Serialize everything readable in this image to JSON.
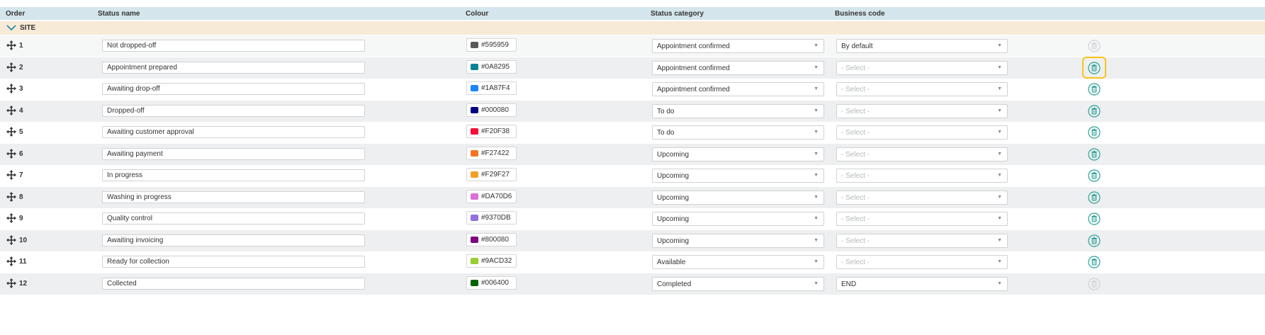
{
  "columns": {
    "order": "Order",
    "status_name": "Status name",
    "colour": "Colour",
    "status_category": "Status category",
    "business_code": "Business code"
  },
  "group": {
    "label": "SITE"
  },
  "rows": [
    {
      "order": "1",
      "name": "Not dropped-off",
      "hex": "#595959",
      "color": "#595959",
      "category": "Appointment confirmed",
      "business": "By default",
      "business_placeholder": false,
      "delete_enabled": false
    },
    {
      "order": "2",
      "name": "Appointment prepared",
      "hex": "#0A8295",
      "color": "#0A8295",
      "category": "Appointment confirmed",
      "business": "- Select -",
      "business_placeholder": true,
      "delete_enabled": true
    },
    {
      "order": "3",
      "name": "Awaiting drop-off",
      "hex": "#1A87F4",
      "color": "#1A87F4",
      "category": "Appointment confirmed",
      "business": "- Select -",
      "business_placeholder": true,
      "delete_enabled": true
    },
    {
      "order": "4",
      "name": "Dropped-off",
      "hex": "#000080",
      "color": "#000080",
      "category": "To do",
      "business": "- Select -",
      "business_placeholder": true,
      "delete_enabled": true
    },
    {
      "order": "5",
      "name": "Awaiting customer approval",
      "hex": "#F20F38",
      "color": "#F20F38",
      "category": "To do",
      "business": "- Select -",
      "business_placeholder": true,
      "delete_enabled": true
    },
    {
      "order": "6",
      "name": "Awaiting payment",
      "hex": "#F27422",
      "color": "#F27422",
      "category": "Upcoming",
      "business": "- Select -",
      "business_placeholder": true,
      "delete_enabled": true
    },
    {
      "order": "7",
      "name": "In progress",
      "hex": "#F29F27",
      "color": "#F29F27",
      "category": "Upcoming",
      "business": "- Select -",
      "business_placeholder": true,
      "delete_enabled": true
    },
    {
      "order": "8",
      "name": "Washing in progress",
      "hex": "#DA70D6",
      "color": "#DA70D6",
      "category": "Upcoming",
      "business": "- Select -",
      "business_placeholder": true,
      "delete_enabled": true
    },
    {
      "order": "9",
      "name": "Quality control",
      "hex": "#9370DB",
      "color": "#9370DB",
      "category": "Upcoming",
      "business": "- Select -",
      "business_placeholder": true,
      "delete_enabled": true
    },
    {
      "order": "10",
      "name": "Awaiting invoicing",
      "hex": "#800080",
      "color": "#800080",
      "category": "Upcoming",
      "business": "- Select -",
      "business_placeholder": true,
      "delete_enabled": true
    },
    {
      "order": "11",
      "name": "Ready for collection",
      "hex": "#9ACD32",
      "color": "#9ACD32",
      "category": "Available",
      "business": "- Select -",
      "business_placeholder": true,
      "delete_enabled": true
    },
    {
      "order": "12",
      "name": "Collected",
      "hex": "#006400",
      "color": "#006400",
      "category": "Completed",
      "business": "END",
      "business_placeholder": false,
      "delete_enabled": false
    }
  ],
  "colors": {
    "header_bg": "#d4e6ec",
    "group_bg": "#f7ead6",
    "accent_teal": "#2aa198",
    "disabled_icon": "#cfd3d6",
    "focus_ring": "#f5c518"
  },
  "icons": {
    "drag": "move-arrows-icon",
    "delete": "trash-icon",
    "expand": "chevron-down-icon",
    "dropdown": "caret-down-icon"
  }
}
